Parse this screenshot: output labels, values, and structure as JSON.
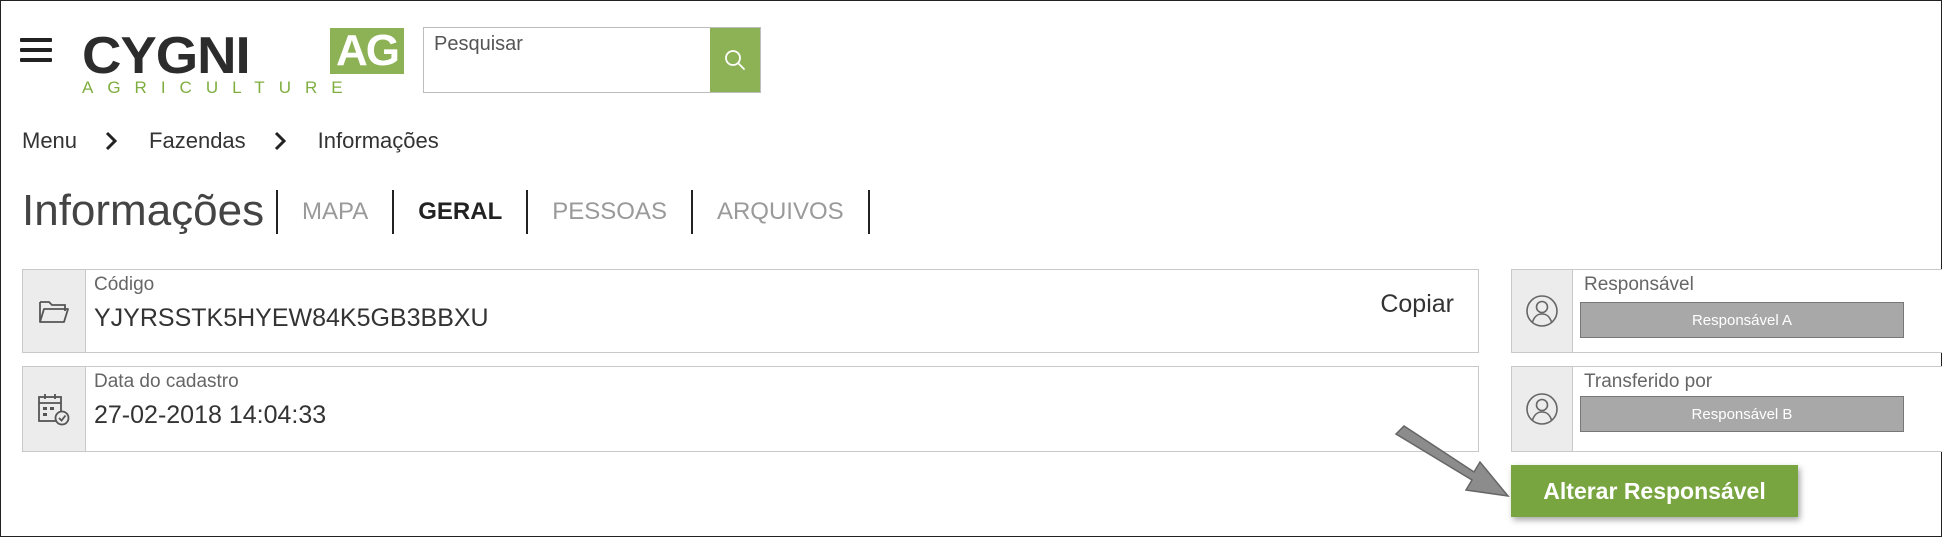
{
  "header": {
    "logo_main": "CYGNI",
    "logo_ag": "AG",
    "logo_sub": "AGRICULTURE",
    "search_placeholder": "Pesquisar",
    "accent_color": "#8db255"
  },
  "breadcrumb": [
    "Menu",
    "Fazendas",
    "Informações"
  ],
  "page_title": "Informações",
  "tabs": [
    {
      "label": "MAPA",
      "active": false
    },
    {
      "label": "GERAL",
      "active": true
    },
    {
      "label": "PESSOAS",
      "active": false
    },
    {
      "label": "ARQUIVOS",
      "active": false
    }
  ],
  "info": {
    "code": {
      "label": "Código",
      "value": "YJYRSSTK5HYEW84K5GB3BBXU",
      "copy_label": "Copiar",
      "icon": "folder-icon"
    },
    "date": {
      "label": "Data do cadastro",
      "value": "27-02-2018 14:04:33",
      "icon": "calendar-check-icon"
    }
  },
  "responsible": {
    "owner": {
      "label": "Responsável",
      "value": "Responsável A",
      "icon": "user-icon"
    },
    "transferred": {
      "label": "Transferido por",
      "value": "Responsável B",
      "icon": "user-icon"
    }
  },
  "actions": {
    "change_responsible": "Alterar Responsável"
  }
}
